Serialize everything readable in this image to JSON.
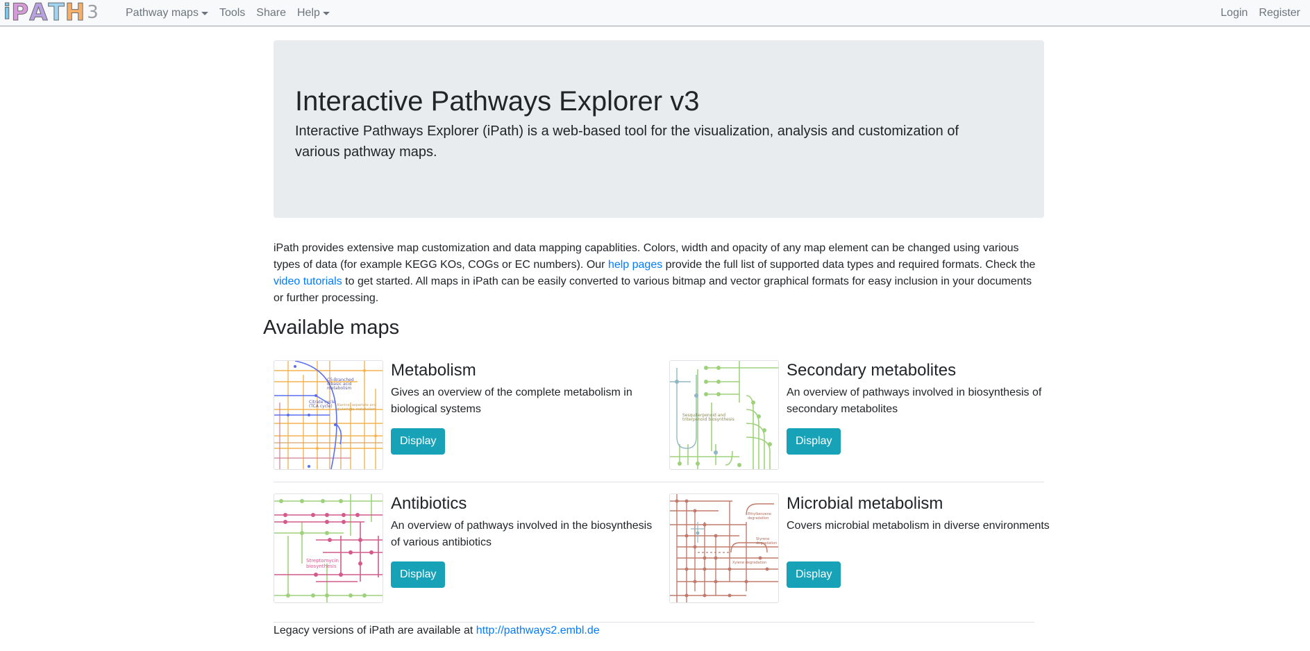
{
  "navbar": {
    "logo_text": "iPATH",
    "logo_version": "3",
    "items": [
      {
        "label": "Pathway maps",
        "dropdown": true
      },
      {
        "label": "Tools",
        "dropdown": false
      },
      {
        "label": "Share",
        "dropdown": false
      },
      {
        "label": "Help",
        "dropdown": true
      }
    ],
    "login_label": "Login",
    "register_label": "Register"
  },
  "hero": {
    "title": "Interactive Pathways Explorer v3",
    "subtitle": "Interactive Pathways Explorer (iPath) is a web-based tool for the visualization, analysis and customization of various pathway maps."
  },
  "intro": {
    "part1": "iPath provides extensive map customization and data mapping capablities. Colors, width and opacity of any map element can be changed using various types of data (for example KEGG KOs, COGs or EC numbers). Our ",
    "help_link": "help pages",
    "part2": " provide the full list of supported data types and required formats. Check the ",
    "video_link": "video tutorials",
    "part3": " to get started. All maps in iPath can be easily converted to various bitmap and vector graphical formats for easy inclusion in your documents or further processing."
  },
  "maps_heading": "Available maps",
  "maps": [
    {
      "title": "Metabolism",
      "description": "Gives an overview of the complete metabolism in biological systems",
      "button": "Display",
      "thumb_labels": [
        "C5-Branched",
        "dibasic acid",
        "metabolism",
        "Citrate cycle",
        "(TCA cycle)",
        "Alanine, aspartate and",
        "glutamate metabolism"
      ]
    },
    {
      "title": "Secondary metabolites",
      "description": "An overview of pathways involved in biosynthesis of secondary metabolites",
      "button": "Display",
      "thumb_labels": [
        "Sesquiterpenoid and",
        "triterpenoid biosynthesis"
      ]
    },
    {
      "title": "Antibiotics",
      "description": "An overview of pathways involved in the biosynthesis of various antibiotics",
      "button": "Display",
      "thumb_labels": [
        "Streptomycin",
        "biosynthesis"
      ]
    },
    {
      "title": "Microbial metabolism",
      "description": "Covers microbial metabolism in diverse environments",
      "button": "Display",
      "thumb_labels": [
        "Ethylbenzene",
        "degradation",
        "Xylene degradation",
        "Styrene",
        "degradation"
      ]
    }
  ],
  "footer": {
    "text": "Legacy versions of iPath are available at ",
    "link": "http://pathways2.embl.de"
  },
  "colors": {
    "accent_button": "#17a2b8",
    "link": "#007bff",
    "hero_bg": "#e9ecef",
    "metabolism_blue": "#5b6ef0",
    "metabolism_orange": "#f5b34f",
    "secondary_green": "#9ed27a",
    "antibiotics_pink": "#d45a8b",
    "microbial_brown": "#c27a6a"
  }
}
